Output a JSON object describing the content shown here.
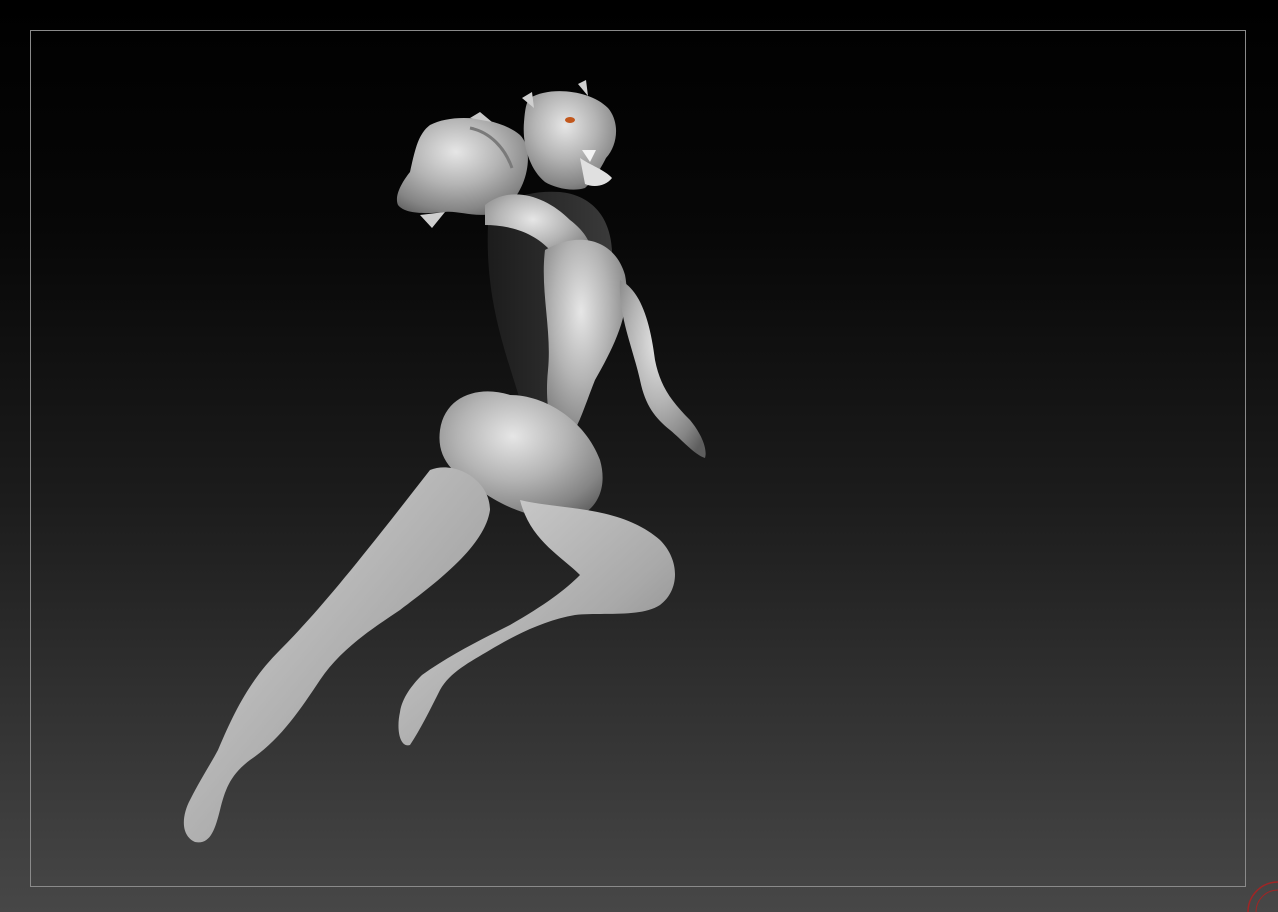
{
  "app": {
    "viewport": "3d-sculpt-canvas",
    "icons": {
      "gizmo": "axis-gyro-icon"
    }
  },
  "colors": {
    "frame": "#8a8a8a",
    "model": "#b8b8b8",
    "model_shadow": "#2a2a2a",
    "eye": "#c2571c",
    "gyro": "#a02525"
  }
}
